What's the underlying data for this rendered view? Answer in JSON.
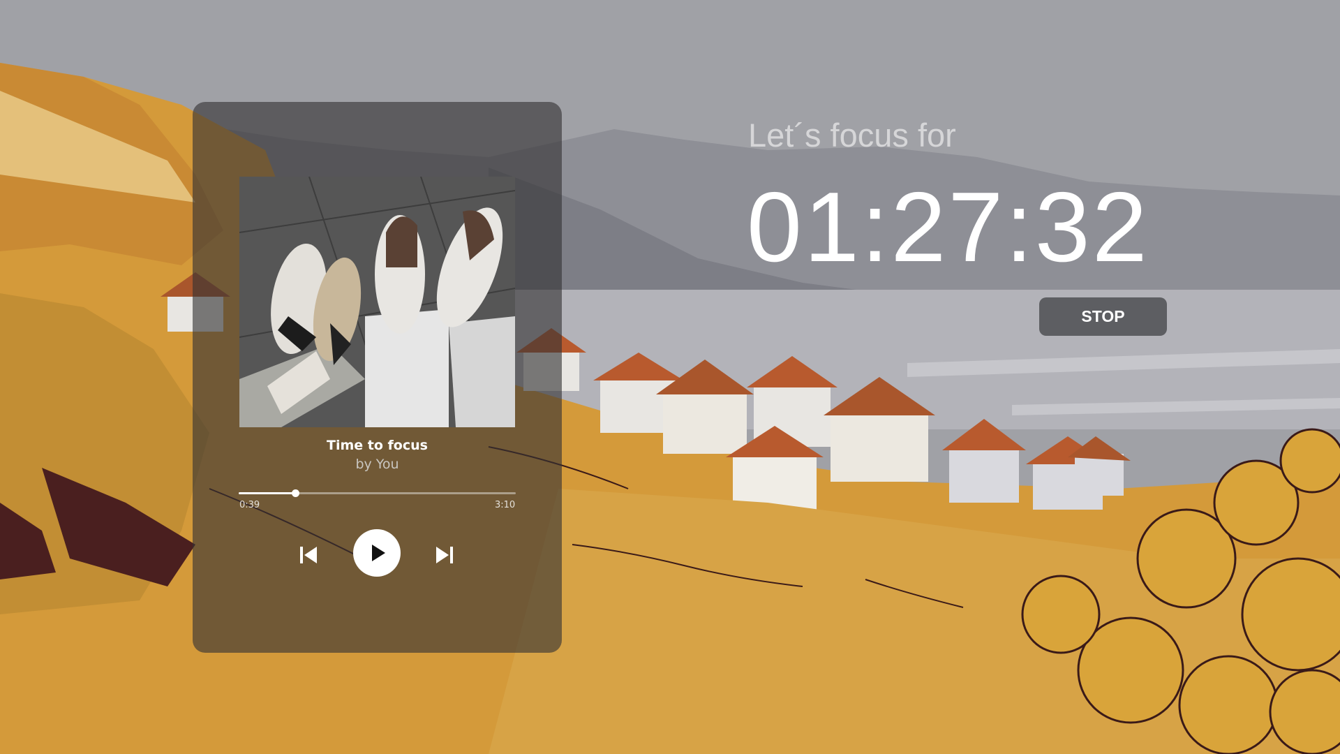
{
  "colors": {
    "sky": "#a0a1a6",
    "hills": "#d49a3a",
    "card_overlay": "#343234",
    "stop_button": "#5d5e62"
  },
  "player": {
    "track_title": "Time to focus",
    "track_artist": "by You",
    "time_elapsed": "0:39",
    "time_total": "3:10",
    "progress_fraction": 0.205,
    "cover_icon": "sneakers-artwork",
    "controls": {
      "previous_icon": "skip-previous-icon",
      "play_icon": "play-icon",
      "next_icon": "skip-next-icon"
    }
  },
  "focus": {
    "label": "Let´s focus for",
    "timer": "01:27:32",
    "stop_label": "STOP"
  }
}
